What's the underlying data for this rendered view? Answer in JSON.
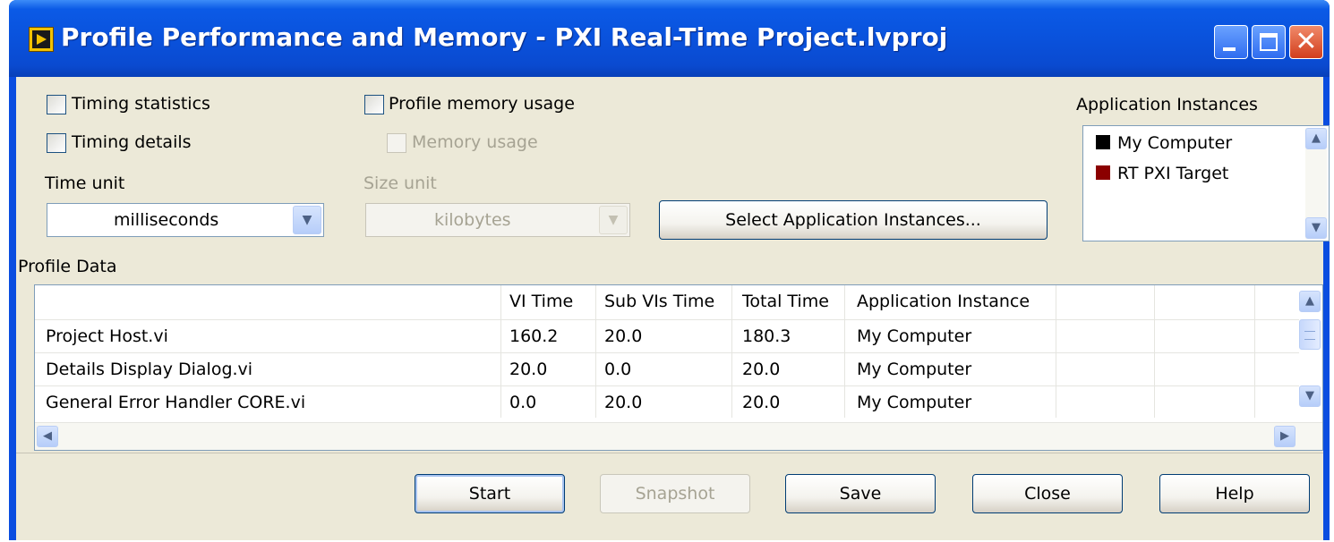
{
  "window": {
    "title": "Profile Performance and Memory - PXI Real-Time Project.lvproj"
  },
  "options": {
    "timing_statistics": {
      "label": "Timing statistics",
      "checked": false
    },
    "timing_details": {
      "label": "Timing details",
      "checked": false
    },
    "profile_memory_usage": {
      "label": "Profile memory usage",
      "checked": false
    },
    "memory_usage": {
      "label": "Memory usage",
      "checked": false,
      "enabled": false
    },
    "time_unit": {
      "label": "Time unit",
      "value": "milliseconds"
    },
    "size_unit": {
      "label": "Size unit",
      "value": "kilobytes",
      "enabled": false
    },
    "select_instances_button": "Select Application Instances..."
  },
  "app_instances": {
    "label": "Application Instances",
    "items": [
      {
        "name": "My Computer",
        "color": "#000000"
      },
      {
        "name": "RT PXI Target",
        "color": "#8b0000"
      }
    ]
  },
  "profile_data": {
    "label": "Profile Data",
    "columns": [
      "",
      "VI Time",
      "Sub VIs Time",
      "Total Time",
      "Application Instance"
    ],
    "rows": [
      [
        "Project Host.vi",
        "160.2",
        "20.0",
        "180.3",
        "My Computer"
      ],
      [
        "Details Display Dialog.vi",
        "20.0",
        "0.0",
        "20.0",
        "My Computer"
      ],
      [
        "General Error Handler CORE.vi",
        "0.0",
        "20.0",
        "20.0",
        "My Computer"
      ]
    ]
  },
  "buttons": {
    "start": "Start",
    "snapshot": "Snapshot",
    "save": "Save",
    "close": "Close",
    "help": "Help"
  }
}
